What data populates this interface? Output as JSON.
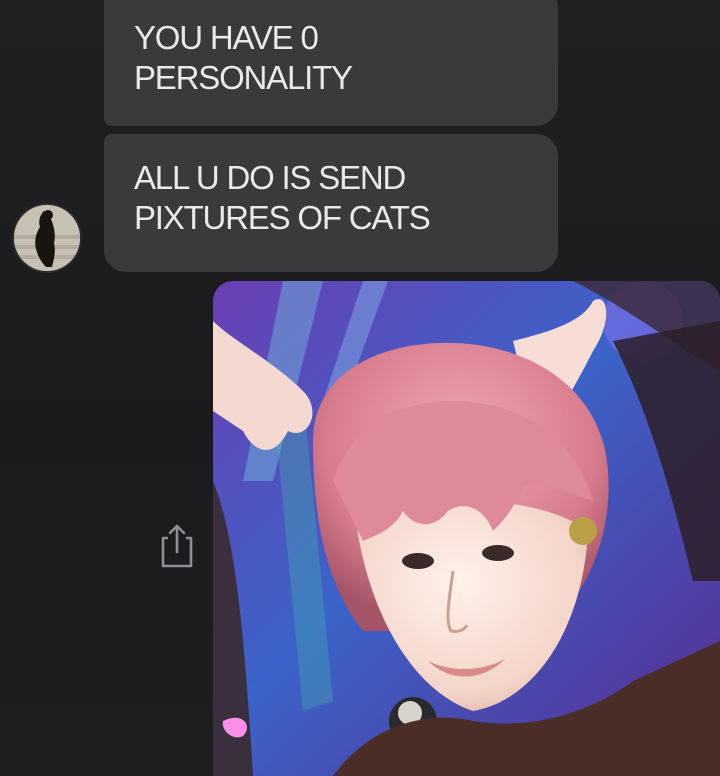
{
  "messages": [
    {
      "text": "YOU HAVE 0\nPERSONALITY"
    },
    {
      "text": "ALL U DO IS SEND\nPIXTURES OF CATS"
    }
  ],
  "icons": {
    "avatar": "contact-avatar",
    "share": "share-icon",
    "photo": "photo-attachment"
  },
  "colors": {
    "background": "#1c1c1e",
    "bubble": "#3a3a3d",
    "bubble_text": "#e9e9e9"
  }
}
